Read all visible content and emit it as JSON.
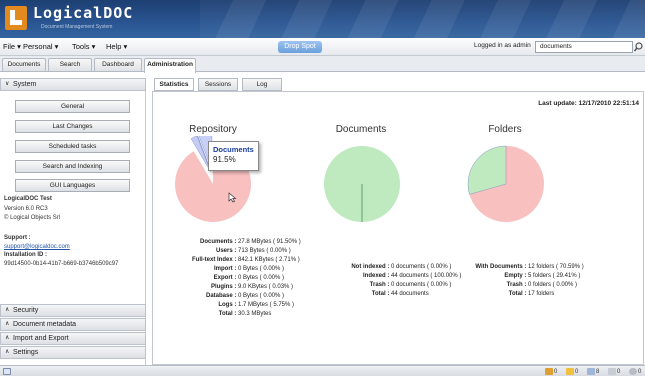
{
  "app": {
    "name": "LogicalDOC",
    "subtitle": "Document Management System"
  },
  "menu": {
    "items": [
      "File ▾",
      "Personal ▾",
      "Tools ▾",
      "Help ▾"
    ],
    "drop_spot": "Drop Spot",
    "logged_in": "Logged in as admin",
    "search_value": "documents"
  },
  "tabs": [
    "Documents",
    "Search",
    "Dashboard",
    "Administration"
  ],
  "sidebar": {
    "system_header": "System",
    "buttons": [
      "General",
      "Last Changes",
      "Scheduled tasks",
      "Search and Indexing",
      "GUI Languages"
    ],
    "info": {
      "product": "LogicalDOC Test",
      "version": "Version 6.0 RC3",
      "copyright": "© Logical Objects Srl",
      "support_label": "Support :",
      "support_link": "support@logicaldoc.com",
      "install_label": "Installation ID :",
      "install_id": "99d14500-0b14-41b7-b669-b3746b509c97"
    },
    "sections": [
      "Security",
      "Document metadata",
      "Import and Export",
      "Settings"
    ]
  },
  "subtabs": [
    "Statistics",
    "Sessions",
    "Log"
  ],
  "last_update": "Last update: 12/17/2010 22:51:14",
  "chart_data": [
    {
      "type": "pie",
      "title": "Repository",
      "categories": [
        "Documents",
        "Users",
        "Full-text Index",
        "Import",
        "Export",
        "Plugins",
        "Database",
        "Logs"
      ],
      "values": [
        91.5,
        0.0,
        2.71,
        0.0,
        0.0,
        0.03,
        0.0,
        5.75
      ],
      "colors": [
        "#f9c0c0",
        "#bfe9bf",
        "#c6cbf5",
        "#f0e0a0",
        "#d8b8e8",
        "#b8e8e8",
        "#e8d0b0",
        "#c8d0f8"
      ],
      "tooltip": {
        "label": "Documents",
        "value": "91.5%"
      }
    },
    {
      "type": "pie",
      "title": "Documents",
      "categories": [
        "Not indexed",
        "Indexed",
        "Trash"
      ],
      "values": [
        0.0,
        100.0,
        0.0
      ],
      "colors": [
        "#f9c0c0",
        "#bfe9bf",
        "#c6cbf5"
      ]
    },
    {
      "type": "pie",
      "title": "Folders",
      "categories": [
        "With Documents",
        "Empty",
        "Trash"
      ],
      "values": [
        70.59,
        29.41,
        0.0
      ],
      "colors": [
        "#f9c0c0",
        "#bfe9bf",
        "#c6cbf5"
      ]
    }
  ],
  "stats": {
    "repository": [
      [
        "Documents :",
        "27.8 MBytes ( 91.50% )"
      ],
      [
        "Users :",
        "713 Bytes ( 0.00% )"
      ],
      [
        "Full-text Index :",
        "842.1 KBytes ( 2.71% )"
      ],
      [
        "Import :",
        "0 Bytes ( 0.00% )"
      ],
      [
        "Export :",
        "0 Bytes ( 0.00% )"
      ],
      [
        "Plugins :",
        "9.0 KBytes ( 0.03% )"
      ],
      [
        "Database :",
        "0 Bytes ( 0.00% )"
      ],
      [
        "Logs :",
        "1.7 MBytes ( 5.75% )"
      ],
      [
        "Total :",
        "30.3 MBytes"
      ]
    ],
    "documents": [
      [
        "Not indexed :",
        "0 documents ( 0.00% )"
      ],
      [
        "Indexed :",
        "44 documents ( 100.00% )"
      ],
      [
        "Trash :",
        "0 documents ( 0.00% )"
      ],
      [
        "Total :",
        "44 documents"
      ]
    ],
    "folders": [
      [
        "With Documents :",
        "12 folders ( 70.59% )"
      ],
      [
        "Empty :",
        "5 folders ( 29.41% )"
      ],
      [
        "Trash :",
        "0 folders ( 0.00% )"
      ],
      [
        "Total :",
        "17 folders"
      ]
    ]
  },
  "statusbar": [
    "0",
    "0",
    "8",
    "0",
    "0"
  ]
}
